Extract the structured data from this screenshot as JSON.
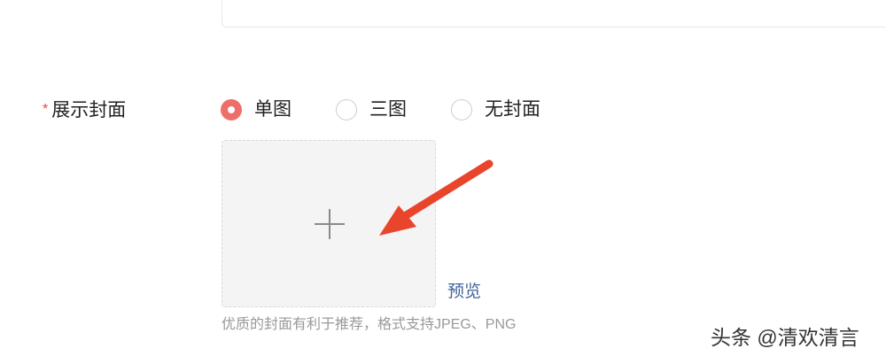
{
  "cover_field": {
    "required_mark": "*",
    "label": "展示封面",
    "options": [
      {
        "label": "单图",
        "checked": true
      },
      {
        "label": "三图",
        "checked": false
      },
      {
        "label": "无封面",
        "checked": false
      }
    ],
    "upload_icon": "plus-icon",
    "preview_label": "预览",
    "hint": "优质的封面有利于推荐，格式支持JPEG、PNG"
  },
  "annotation": {
    "arrow_icon": "red-arrow-icon",
    "arrow_color": "#e8452c"
  },
  "watermark": "头条 @清欢清言",
  "colors": {
    "accent": "#ee6e6a",
    "required": "#f04142",
    "link": "#406599",
    "hint": "#999999"
  }
}
